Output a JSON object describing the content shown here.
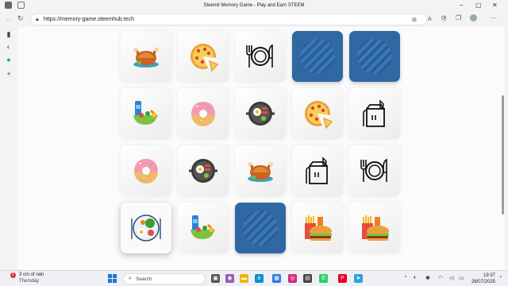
{
  "window": {
    "title": "Steemit Memory Game - Play and Earn STEEM"
  },
  "browser": {
    "url": "https://memory-game.steemhub.tech",
    "back_icon": "back-arrow-icon",
    "refresh_icon": "refresh-icon"
  },
  "board": {
    "rows": [
      [
        "roast-chicken",
        "pizza",
        "plate-cutlery",
        "hidden",
        "hidden"
      ],
      [
        "salad-drink",
        "donut",
        "pan-dish",
        "pizza",
        "takeaway-bag"
      ],
      [
        "donut",
        "pan-dish",
        "roast-chicken",
        "takeaway-bag",
        "plate-cutlery"
      ],
      [
        "healthy-plate",
        "salad-drink",
        "hidden",
        "burger-fries",
        "burger-fries"
      ]
    ],
    "selected": [
      3,
      0
    ],
    "back_color": "#2f68a2"
  },
  "taskbar": {
    "weather_temp": "3 cm of rain",
    "weather_day": "Thursday",
    "weather_badge": "1",
    "search_placeholder": "Search",
    "time": "19:37",
    "date": "28/07/2025"
  }
}
